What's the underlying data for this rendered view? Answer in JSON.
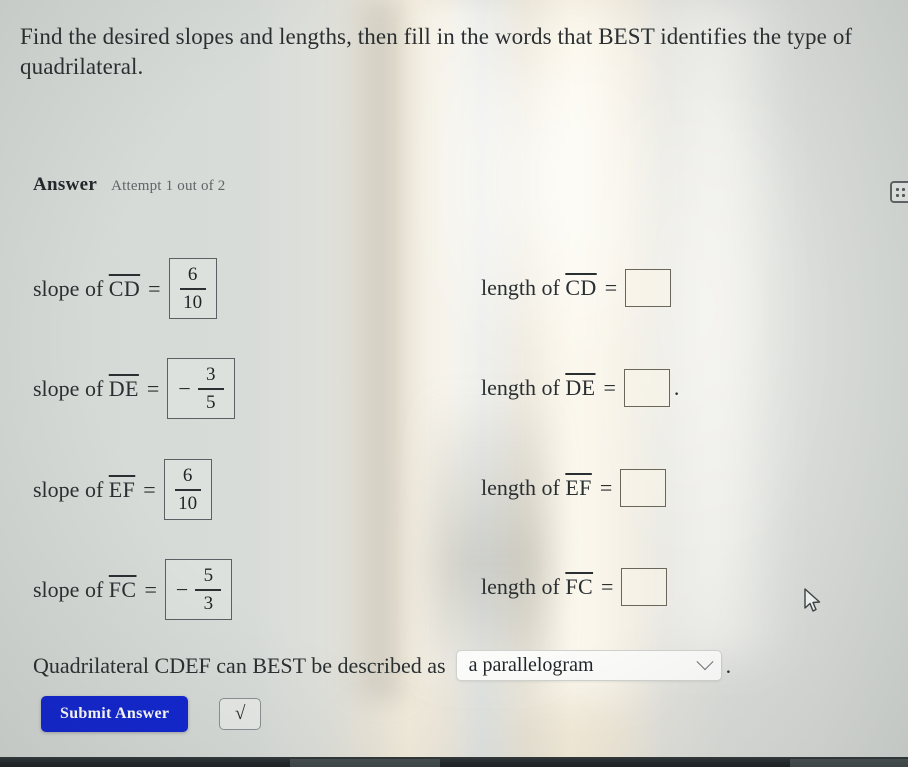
{
  "prompt": "Find the desired slopes and lengths, then fill in the words that BEST identifies the type of quadrilateral.",
  "answer_section": {
    "title": "Answer",
    "attempt": "Attempt 1 out of 2",
    "keyboard_icon": "keyboard-icon"
  },
  "slopes": [
    {
      "label_prefix": "slope of ",
      "segment": "CD",
      "equals": "=",
      "negative": "",
      "numerator": "6",
      "denominator": "10"
    },
    {
      "label_prefix": "slope of ",
      "segment": "DE",
      "equals": "=",
      "negative": "−",
      "numerator": "3",
      "denominator": "5"
    },
    {
      "label_prefix": "slope of ",
      "segment": "EF",
      "equals": "=",
      "negative": "",
      "numerator": "6",
      "denominator": "10"
    },
    {
      "label_prefix": "slope of ",
      "segment": "FC",
      "equals": "=",
      "negative": "−",
      "numerator": "5",
      "denominator": "3"
    }
  ],
  "lengths": [
    {
      "label_prefix": "length of ",
      "segment": "CD",
      "equals": "=",
      "value": "",
      "trailing": ""
    },
    {
      "label_prefix": "length of ",
      "segment": "DE",
      "equals": "=",
      "value": "",
      "trailing": "."
    },
    {
      "label_prefix": "length of ",
      "segment": "EF",
      "equals": "=",
      "value": "",
      "trailing": ""
    },
    {
      "label_prefix": "length of ",
      "segment": "FC",
      "equals": "=",
      "value": "",
      "trailing": ""
    }
  ],
  "description": {
    "sentence": "Quadrilateral CDEF can BEST be described as",
    "selected_option": "a parallelogram",
    "chevron_icon": "chevron-down-icon",
    "period": "."
  },
  "actions": {
    "submit_label": "Submit Answer",
    "sqrt_label": "√",
    "sqrt_icon": "square-root-icon"
  },
  "colors": {
    "submit_bg": "#1226cf",
    "submit_text": "#ffffff",
    "page_bg": "#d8dcd9",
    "text": "#2a2f31",
    "muted_text": "#5e6568"
  },
  "cursor_icon": "mouse-pointer-icon"
}
